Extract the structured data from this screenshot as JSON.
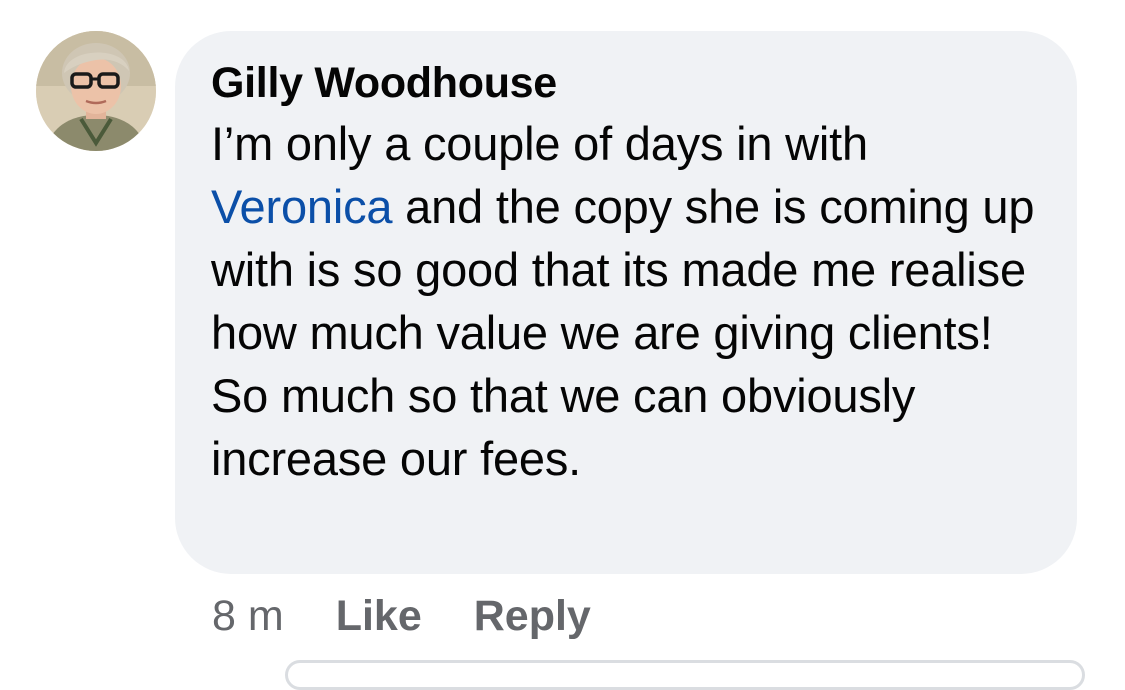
{
  "comment": {
    "author": "Gilly Woodhouse",
    "text_before_mention": "I’m only a couple of days in with ",
    "mention": "Veronica",
    "text_after_mention": " and the copy she is coming up with is so good that its made me realise how much value we are giving clients! So much so that we can obviously increase our fees.",
    "timestamp": "8 m",
    "like_label": "Like",
    "reply_label": "Reply"
  },
  "colors": {
    "bubble_background": "#f0f2f5",
    "mention_link": "#0b4fa8",
    "meta_text": "#65676b"
  },
  "icons": {
    "avatar": "profile-photo-avatar"
  }
}
